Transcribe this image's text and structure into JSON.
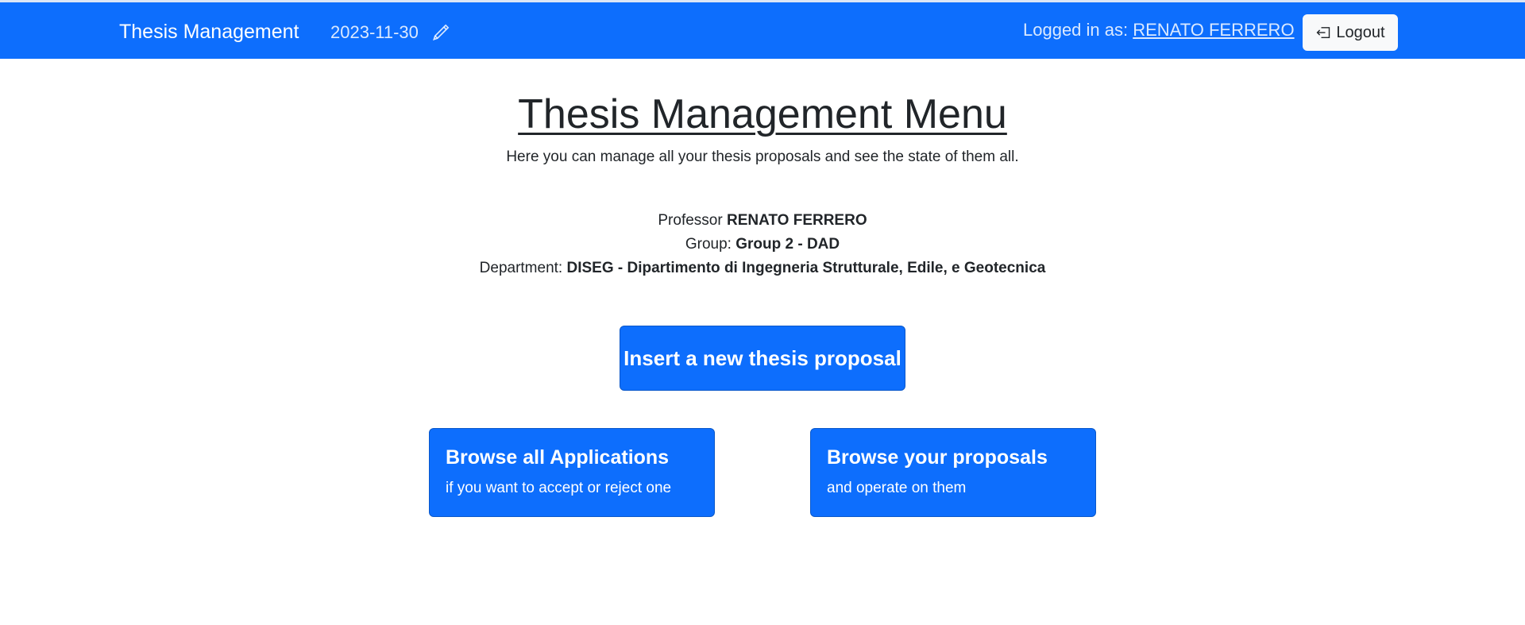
{
  "navbar": {
    "brand": "Thesis Management",
    "date": "2023-11-30",
    "logged_in_prefix": "Logged in as: ",
    "logged_in_user": "RENATO FERRERO",
    "logout_label": "Logout",
    "background_color": "#0d6efd",
    "edit_icon": "pencil-icon",
    "logout_icon": "box-arrow-left-icon"
  },
  "main": {
    "title": "Thesis Management Menu",
    "subtitle": "Here you can manage all your thesis proposals and see the state of them all.",
    "professor_label": "Professor ",
    "professor_name": "RENATO FERRERO",
    "group_label": "Group: ",
    "group_value": "Group 2 - DAD",
    "department_label": "Department: ",
    "department_value": "DISEG - Dipartimento di Ingegneria Strutturale, Edile, e Geotecnica"
  },
  "actions": {
    "insert_label": "Insert a new thesis proposal",
    "applications_title": "Browse all Applications",
    "applications_sub": "if you want to accept or reject one",
    "proposals_title": "Browse your proposals",
    "proposals_sub": "and operate on them",
    "button_color": "#0d6efd"
  }
}
